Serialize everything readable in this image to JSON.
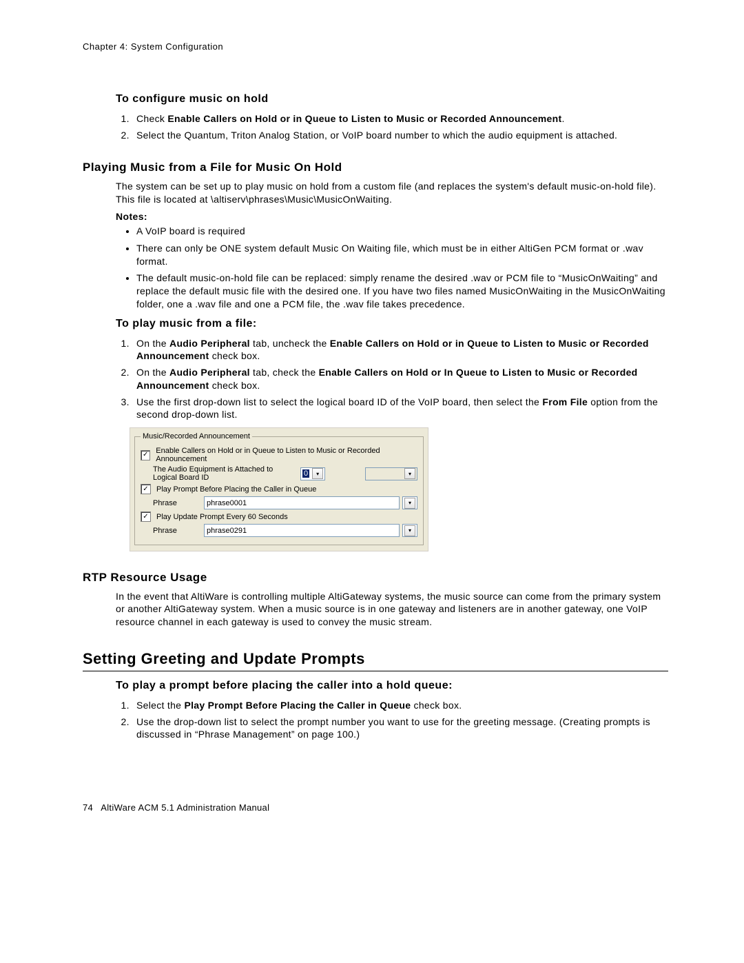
{
  "chapter_header": "Chapter 4: System Configuration",
  "sec1": {
    "title": "To configure music on hold",
    "steps": [
      {
        "pre": "Check ",
        "bold": "Enable Callers on Hold or in Queue to Listen to Music or Recorded Announcement",
        "post": "."
      },
      {
        "pre": "Select the Quantum, Triton Analog Station, or VoIP board number to which the audio equipment is attached.",
        "bold": "",
        "post": ""
      }
    ]
  },
  "sec2": {
    "title": "Playing Music from a File for Music On Hold",
    "p1": "The system can be set up to play music on hold from a custom file (and replaces the system's default music-on-hold file). This file is located at \\altiserv\\phrases\\Music\\MusicOnWaiting.",
    "notes_label": "Notes:",
    "bullets": [
      "A VoIP board is required",
      "There can only be ONE system default Music On Waiting file, which must be in either AltiGen PCM format or .wav format.",
      "The default music-on-hold file can be replaced: simply rename the desired .wav or PCM file to “MusicOnWaiting” and replace the default music file with the desired one. If you have two files named MusicOnWaiting in the MusicOnWaiting folder, one a .wav file and one a PCM file, the .wav file takes precedence."
    ]
  },
  "sec3": {
    "title": "To play music from a file:",
    "steps": [
      {
        "pre": "On the ",
        "b1": "Audio Peripheral",
        "mid1": " tab, uncheck the ",
        "b2": "Enable Callers on Hold or in Queue to Listen to Music or Recorded Announcement",
        "post": " check box."
      },
      {
        "pre": "On the ",
        "b1": "Audio Peripheral",
        "mid1": " tab, check the ",
        "b2": "Enable Callers on Hold or In Queue to Listen to Music or Recorded Announcement",
        "post": " check box."
      },
      {
        "pre": "Use the first drop-down list to select the logical board ID of the VoIP board, then select the ",
        "b1": "From File",
        "post": " option from the second drop-down list."
      }
    ]
  },
  "dialog": {
    "legend": "Music/Recorded Announcement",
    "chk1": "Enable Callers on Hold or in Queue to Listen to Music or Recorded Announcement",
    "board_label": "The Audio Equipment is Attached to Logical Board ID",
    "board_value": "0",
    "chk2": "Play Prompt Before Placing the Caller in Queue",
    "phrase_label": "Phrase",
    "phrase1_value": "phrase0001",
    "chk3": "Play Update Prompt Every 60 Seconds",
    "phrase2_value": "phrase0291"
  },
  "sec4": {
    "title": "RTP Resource Usage",
    "p1": "In the event that AltiWare is controlling multiple AltiGateway systems, the music source can come from the primary system or another AltiGateway system. When a music source is in one gateway and listeners are in another gateway, one VoIP resource channel in each gateway is used to convey the music stream."
  },
  "sec5": {
    "title": "Setting Greeting and Update Prompts",
    "sub_title": "To play a prompt before placing the caller into a hold queue:",
    "steps": [
      {
        "pre": "Select the ",
        "b1": "Play Prompt Before Placing the Caller in Queue",
        "post": " check box."
      },
      {
        "pre": "Use the drop-down list to select the prompt number you want to use for the greeting message. (Creating prompts is discussed in “Phrase Management” on page 100.)",
        "b1": "",
        "post": ""
      }
    ]
  },
  "footer": {
    "page": "74",
    "book": "AltiWare ACM 5.1 Administration Manual"
  }
}
